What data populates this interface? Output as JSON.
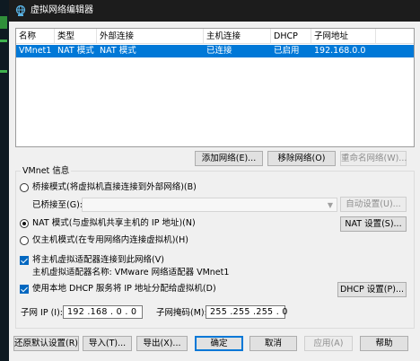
{
  "window": {
    "title": "虚拟网络编辑器",
    "icon": "vmware-network-icon"
  },
  "table": {
    "columns": [
      "名称",
      "类型",
      "外部连接",
      "主机连接",
      "DHCP",
      "子网地址"
    ],
    "rows": [
      {
        "name": "VMnet1",
        "type": "NAT 模式",
        "external": "NAT 模式",
        "host": "已连接",
        "dhcp": "已启用",
        "subnet": "192.168.0.0",
        "selected": true
      }
    ]
  },
  "list_buttons": {
    "add": "添加网络(E)...",
    "remove": "移除网络(O)",
    "rename": "重命名网络(W)..."
  },
  "vmnet_info": {
    "title": "VMnet 信息",
    "bridged": {
      "label": "桥接模式(将虚拟机直接连接到外部网络)(B)",
      "checked": false
    },
    "bridged_to": {
      "label": "已桥接至(G):",
      "value": ""
    },
    "auto_settings": "自动设置(U)...",
    "nat": {
      "label": "NAT 模式(与虚拟机共享主机的 IP 地址)(N)",
      "checked": true
    },
    "nat_settings": "NAT 设置(S)...",
    "host_only": {
      "label": "仅主机模式(在专用网络内连接虚拟机)(H)",
      "checked": false
    },
    "connect_adapter": {
      "label": "将主机虚拟适配器连接到此网络(V)",
      "checked": true
    },
    "adapter_name": "主机虚拟适配器名称: VMware 网络适配器 VMnet1",
    "use_dhcp": {
      "label": "使用本地 DHCP 服务将 IP 地址分配给虚拟机(D)",
      "checked": true
    },
    "dhcp_settings": "DHCP 设置(P)...",
    "subnet_ip": {
      "label": "子网 IP (I):",
      "value": "192 .168 . 0 . 0"
    },
    "subnet_mask": {
      "label": "子网掩码(M):",
      "value": "255 .255 .255 . 0"
    }
  },
  "footer_buttons": {
    "restore": "还原默认设置(R)",
    "import": "导入(T)...",
    "export": "导出(X)...",
    "ok": "确定",
    "cancel": "取消",
    "apply": "应用(A)",
    "help": "帮助"
  },
  "colors": {
    "selection": "#0078d7",
    "titlebar": "#1c1c1c",
    "window_bg": "#f0f0f0",
    "checkbox": "#0067c0"
  }
}
